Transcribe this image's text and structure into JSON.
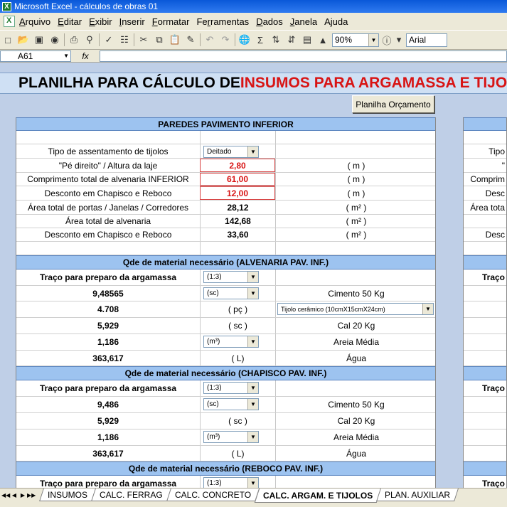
{
  "window": {
    "title": "Microsoft Excel - cálculos de obras 01",
    "app_icon": "excel-icon"
  },
  "menu": [
    {
      "label": "Arquivo",
      "u": "A",
      "rest": "rquivo"
    },
    {
      "label": "Editar",
      "u": "E",
      "rest": "ditar"
    },
    {
      "label": "Exibir",
      "u": "x",
      "pre": "E",
      "rest": "ibir"
    },
    {
      "label": "Inserir",
      "u": "I",
      "rest": "nserir"
    },
    {
      "label": "Formatar",
      "u": "F",
      "rest": "ormatar"
    },
    {
      "label": "Ferramentas",
      "u": "r",
      "pre": "Fe",
      "rest": "ramentas"
    },
    {
      "label": "Dados",
      "u": "D",
      "rest": "ados"
    },
    {
      "label": "Janela",
      "u": "J",
      "rest": "anela"
    },
    {
      "label": "Ajuda",
      "u": "j",
      "pre": "A",
      "rest": "uda"
    }
  ],
  "toolbar": {
    "zoom": "90%",
    "font": "Arial"
  },
  "formula_bar": {
    "name_box": "A61",
    "fx": "fx",
    "value": ""
  },
  "sheet": {
    "banner_black": "PLANILHA PARA CÁLCULO DE ",
    "banner_red": "INSUMOS PARA ARGAMASSA E TIJOLOS",
    "button_orcamento": "Planilha Orçamento",
    "section_paredes": "PAREDES PAVIMENTO INFERIOR",
    "tipo_label": "Tipo de assentamento de tijolos",
    "tipo_value": "Deitado",
    "pe_direito_label": "\"Pé direito\" / Altura da laje",
    "pe_direito_value": "2,80",
    "pe_direito_unit": "( m )",
    "comprimento_label": "Comprimento total de alvenaria INFERIOR",
    "comprimento_value": "61,00",
    "comprimento_unit": "( m )",
    "desconto1_label": "Desconto em Chapisco e Reboco",
    "desconto1_value": "12,00",
    "desconto1_unit": "( m )",
    "area_portas_label": "Área total de portas / Janelas / Corredores",
    "area_portas_value": "28,12",
    "area_portas_unit": "( m² )",
    "area_alv_label": "Área total de alvenaria",
    "area_alv_value": "142,68",
    "area_alv_unit": "( m² )",
    "desconto2_label": "Desconto em Chapisco e Reboco",
    "desconto2_value": "33,60",
    "desconto2_unit": "( m² )",
    "alv_header": "Qde de material necessário (ALVENARIA PAV. INF.)",
    "alv_traco_label": "Traço para preparo da argamassa",
    "alv_traco_value": "(1:3)",
    "alv_cimento_value": "9,48565",
    "alv_cimento_unit": "(sc)",
    "alv_cimento_label": "Cimento 50 Kg",
    "alv_tijolo_value": "4.708",
    "alv_tijolo_unit": "( pç )",
    "alv_tijolo_type": "Tijolo cerâmico (10cmX15cmX24cm)",
    "alv_cal_value": "5,929",
    "alv_cal_unit": "( sc )",
    "alv_cal_label": "Cal 20 Kg",
    "alv_areia_value": "1,186",
    "alv_areia_unit": "(m³)",
    "alv_areia_label": "Areia Média",
    "alv_agua_value": "363,617",
    "alv_agua_unit": "( L)",
    "alv_agua_label": "Água",
    "chap_header": "Qde de material necessário (CHAPISCO PAV. INF.)",
    "chap_traco_label": "Traço para preparo da argamassa",
    "chap_traco_value": "(1:3)",
    "chap_cimento_value": "9,486",
    "chap_cimento_unit": "(sc)",
    "chap_cimento_label": "Cimento 50 Kg",
    "chap_cal_value": "5,929",
    "chap_cal_unit": "( sc )",
    "chap_cal_label": "Cal 20 Kg",
    "chap_areia_value": "1,186",
    "chap_areia_unit": "(m³)",
    "chap_areia_label": "Areia Média",
    "chap_agua_value": "363,617",
    "chap_agua_unit": "( L)",
    "chap_agua_label": "Água",
    "reb_header": "Qde de material necessário (REBOCO PAV. INF.)",
    "reb_traco_label": "Traço para preparo da argamassa",
    "reb_traco_value": "(1:3)",
    "right_tipo": "Tipo",
    "right_pe": "\"",
    "right_comprim": "Comprim",
    "right_desc": "Desc",
    "right_area": "Área tota",
    "right_desc2": "Desc",
    "right_traco1": "Traço",
    "right_traco2": "Traço",
    "right_traco3": "Traço"
  },
  "tabs": [
    "INSUMOS",
    "CALC. FERRAG",
    "CALC. CONCRETO",
    "CALC. ARGAM. E TIJOLOS",
    "PLAN. AUXILIAR"
  ],
  "active_tab": "CALC. ARGAM. E TIJOLOS"
}
